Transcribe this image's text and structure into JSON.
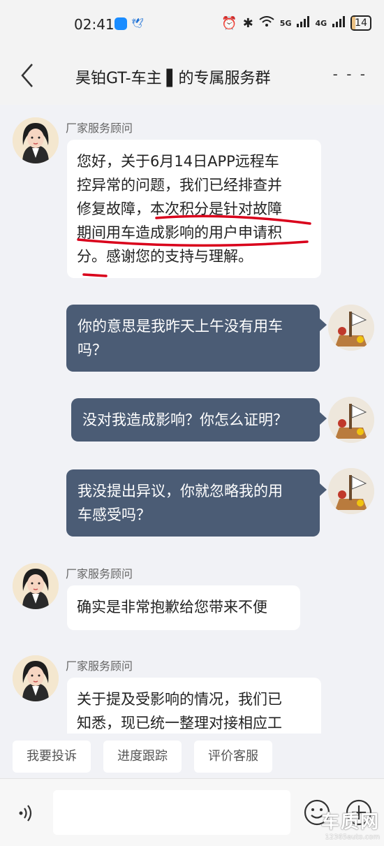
{
  "status_bar": {
    "time": "02:41",
    "network_1": "5G",
    "network_2": "4G",
    "battery": "14"
  },
  "header": {
    "title": "昊铂GT-车主 ▌的专属服务群",
    "more_label": "- - -"
  },
  "messages": [
    {
      "sender": "厂家服务顾问",
      "side": "agent",
      "lines": [
        "您好，关于6月14日APP远程车",
        "控异常的问题，我们已经排查并",
        "修复故障，本次积分是针对故障",
        "期间用车造成影响的用户申请积",
        "分。感谢您的支持与理解。"
      ]
    },
    {
      "side": "me",
      "lines": [
        "你的意思是我昨天上午没有用车",
        "吗？"
      ]
    },
    {
      "side": "me",
      "lines": [
        "没对我造成影响？你怎么证明？"
      ]
    },
    {
      "side": "me",
      "lines": [
        "我没提出异议，你就忽略我的用",
        "车感受吗？"
      ]
    },
    {
      "sender": "厂家服务顾问",
      "side": "agent",
      "lines": [
        "确实是非常抱歉给您带来不便"
      ]
    },
    {
      "sender": "厂家服务顾问",
      "side": "agent",
      "lines": [
        "关于提及受影响的情况，我们已",
        "知悉，现已统一整理对接相应工"
      ]
    }
  ],
  "quick_actions": [
    "我要投诉",
    "进度跟踪",
    "评价客服"
  ],
  "input": {
    "voice_icon": "voice-icon",
    "emoji_icon": "emoji-icon",
    "plus_icon": "plus-icon"
  },
  "watermark": {
    "brand": "车质网",
    "url": "12365auto.com"
  },
  "colors": {
    "my_bubble": "#4b5c75",
    "agent_bubble": "#ffffff",
    "background": "#f1f2f6",
    "annotation_red": "#d9001b"
  }
}
